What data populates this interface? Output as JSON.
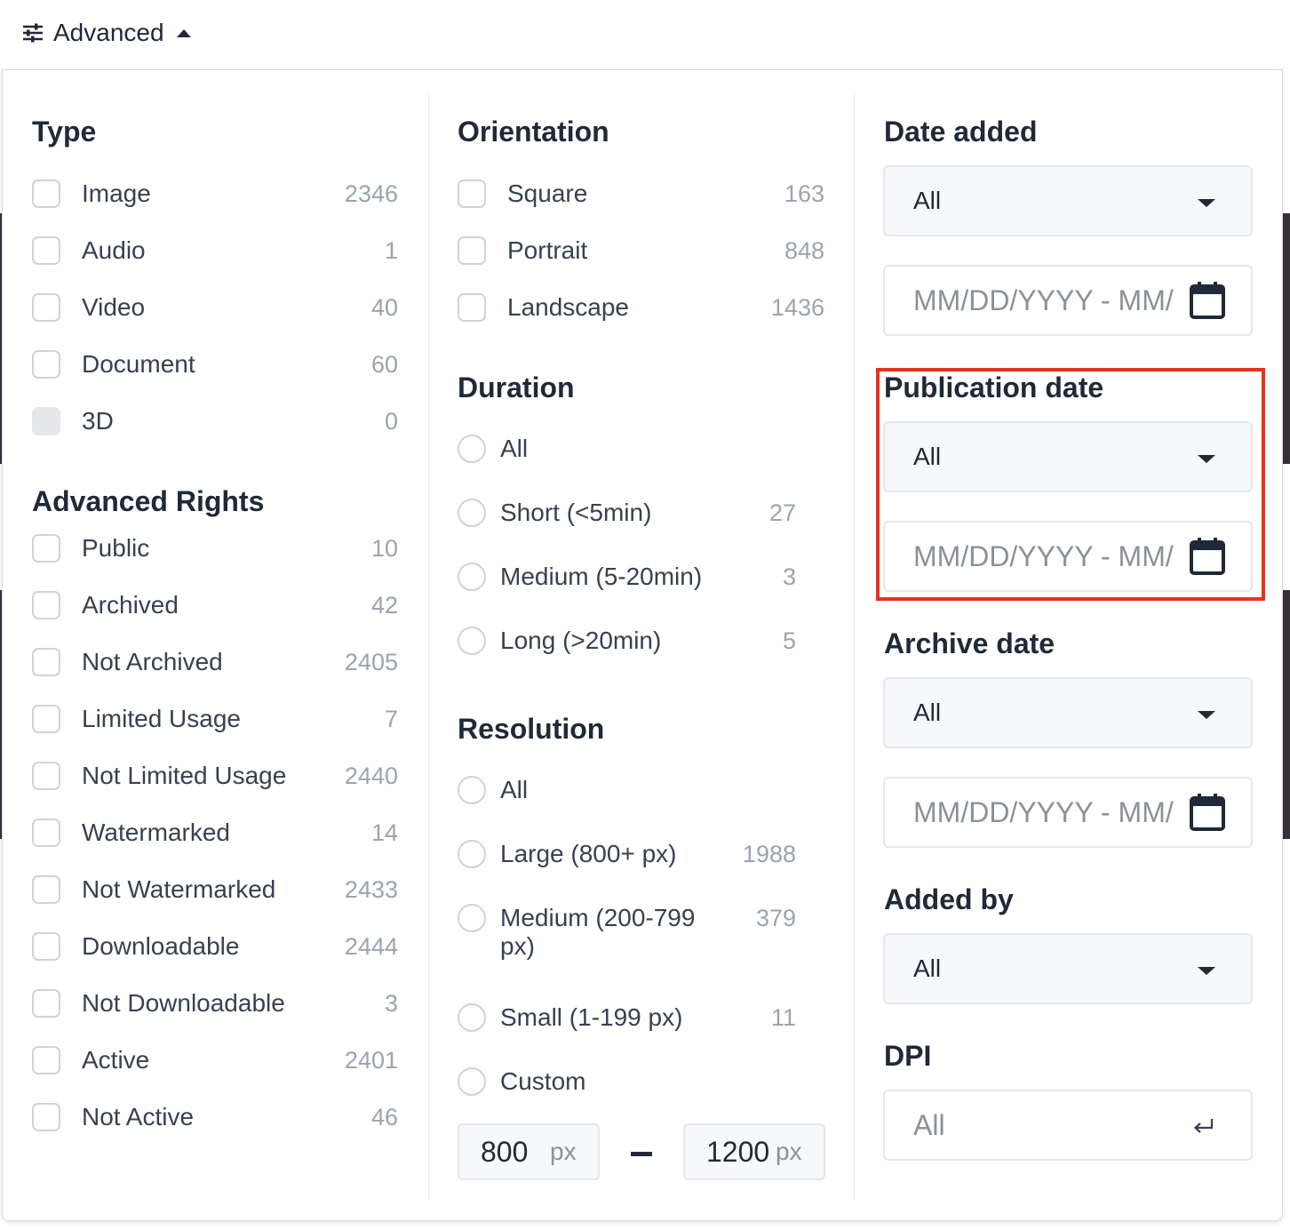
{
  "toolbar": {
    "advanced_label": "Advanced"
  },
  "columns": {
    "type": {
      "title": "Type",
      "items": [
        {
          "label": "Image",
          "count": "2346",
          "disabled": false
        },
        {
          "label": "Audio",
          "count": "1",
          "disabled": false
        },
        {
          "label": "Video",
          "count": "40",
          "disabled": false
        },
        {
          "label": "Document",
          "count": "60",
          "disabled": false
        },
        {
          "label": "3D",
          "count": "0",
          "disabled": true
        }
      ]
    },
    "rights": {
      "title": "Advanced Rights",
      "items": [
        {
          "label": "Public",
          "count": "10"
        },
        {
          "label": "Archived",
          "count": "42"
        },
        {
          "label": "Not Archived",
          "count": "2405"
        },
        {
          "label": "Limited Usage",
          "count": "7"
        },
        {
          "label": "Not Limited Usage",
          "count": "2440"
        },
        {
          "label": "Watermarked",
          "count": "14"
        },
        {
          "label": "Not Watermarked",
          "count": "2433"
        },
        {
          "label": "Downloadable",
          "count": "2444"
        },
        {
          "label": "Not Downloadable",
          "count": "3"
        },
        {
          "label": "Active",
          "count": "2401"
        },
        {
          "label": "Not Active",
          "count": "46"
        }
      ]
    },
    "orientation": {
      "title": "Orientation",
      "items": [
        {
          "label": "Square",
          "count": "163"
        },
        {
          "label": "Portrait",
          "count": "848"
        },
        {
          "label": "Landscape",
          "count": "1436"
        }
      ]
    },
    "duration": {
      "title": "Duration",
      "items": [
        {
          "label": "All",
          "count": ""
        },
        {
          "label": "Short (<5min)",
          "count": "27"
        },
        {
          "label": "Medium (5-20min)",
          "count": "3"
        },
        {
          "label": "Long (>20min)",
          "count": "5"
        }
      ]
    },
    "resolution": {
      "title": "Resolution",
      "items": [
        {
          "label": "All",
          "count": ""
        },
        {
          "label": "Large (800+ px)",
          "count": "1988"
        },
        {
          "label": "Medium (200-799",
          "label2": "px)",
          "count": "379"
        },
        {
          "label": "Small (1-199 px)",
          "count": "11"
        },
        {
          "label": "Custom",
          "count": ""
        }
      ],
      "min_value": "800",
      "max_value": "1200",
      "unit": "px"
    },
    "dates": {
      "date_added": {
        "title": "Date added",
        "select": "All",
        "placeholder": "MM/DD/YYYY - MM/DD/YYYY"
      },
      "publication_date": {
        "title": "Publication date",
        "select": "All",
        "placeholder": "MM/DD/YYYY - MM/DD/YYYY"
      },
      "archive_date": {
        "title": "Archive date",
        "select": "All",
        "placeholder": "MM/DD/YYYY - MM/DD/YYYY"
      },
      "added_by": {
        "title": "Added by",
        "select": "All"
      },
      "dpi": {
        "title": "DPI",
        "placeholder": "All"
      }
    }
  },
  "colors": {
    "highlight": "#e8321c",
    "count_text": "#9ca3af",
    "border": "#e5e7eb"
  }
}
